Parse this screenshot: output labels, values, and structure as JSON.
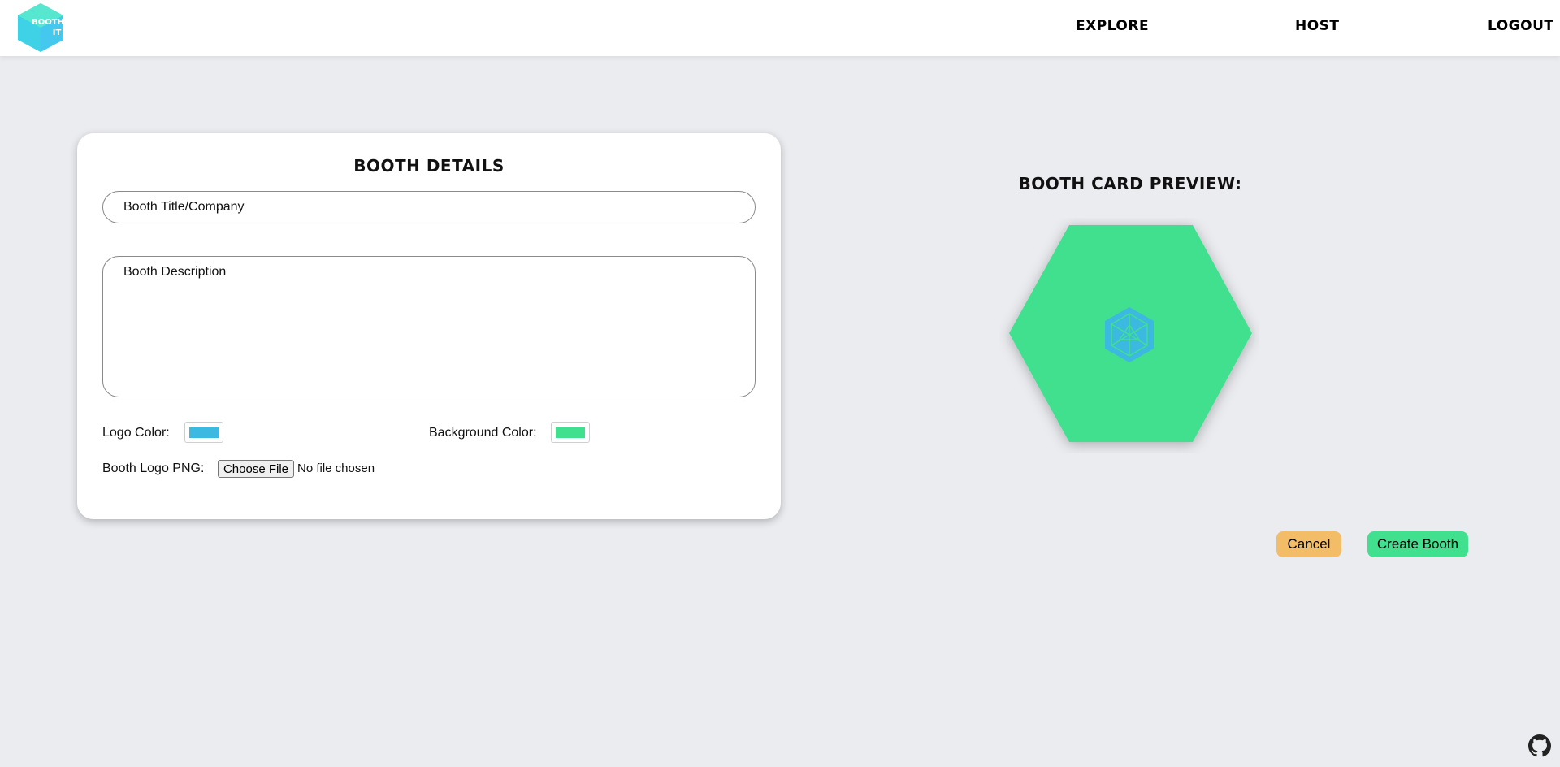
{
  "header": {
    "logo_text": "BOOTH IT",
    "nav": {
      "explore": "EXPLORE",
      "host": "HOST",
      "logout": "LOGOUT"
    }
  },
  "form": {
    "title": "BOOTH DETAILS",
    "title_placeholder": "Booth Title/Company",
    "description_placeholder": "Booth Description",
    "logo_color_label": "Logo Color:",
    "background_color_label": "Background Color:",
    "logo_png_label": "Booth Logo PNG:",
    "file_button": "Choose File",
    "file_status": "No file chosen"
  },
  "preview": {
    "title": "BOOTH CARD PREVIEW:"
  },
  "actions": {
    "cancel": "Cancel",
    "create": "Create Booth"
  },
  "colors": {
    "logo_color": "#3bb9e0",
    "background_color": "#41e08e",
    "cancel": "#f3bd68",
    "create": "#41e08e",
    "page_bg": "#ebecf0"
  },
  "icons": [
    "booth-it-logo-icon",
    "preview-logo-icon",
    "github-icon"
  ]
}
